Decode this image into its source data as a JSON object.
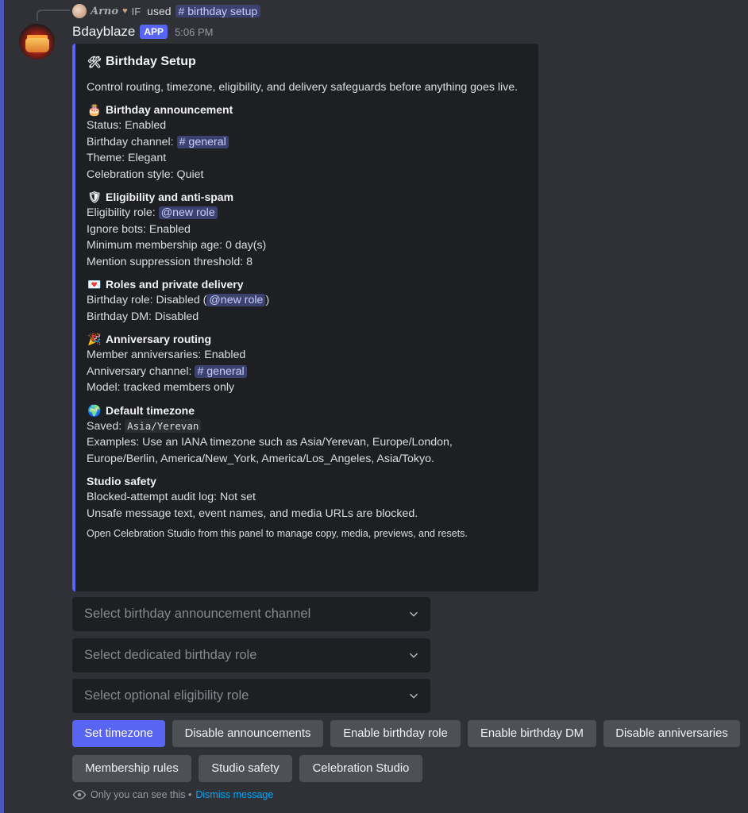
{
  "reply": {
    "user_name": "Arno",
    "heart": "♥",
    "tag": "IF",
    "used_text": "used",
    "command": "# birthday setup"
  },
  "message": {
    "bot_name": "Bdayblaze",
    "badge": "APP",
    "timestamp": "5:06 PM"
  },
  "embed": {
    "title_emoji": "🛠",
    "title": "Birthday Setup",
    "description": "Control routing, timezone, eligibility, and delivery safeguards before anything goes live.",
    "accent_color": "#5865f2",
    "sections": {
      "announcement": {
        "emoji": "🎂",
        "heading": "Birthday announcement",
        "status": "Status: Enabled",
        "channel_label": "Birthday channel:",
        "channel_mention": "# general",
        "theme": "Theme: Elegant",
        "style": "Celebration style: Quiet"
      },
      "eligibility": {
        "emoji": "🛡",
        "heading": "Eligibility and anti-spam",
        "role_label": "Eligibility role:",
        "role_mention": "@new role",
        "ignore_bots": "Ignore bots: Enabled",
        "min_age": "Minimum membership age: 0 day(s)",
        "mention_threshold": "Mention suppression threshold: 8"
      },
      "roles": {
        "emoji": "💌",
        "heading": "Roles and private delivery",
        "role_prefix": "Birthday role: Disabled (",
        "role_mention": "@new role",
        "role_suffix": ")",
        "dm": "Birthday DM: Disabled"
      },
      "anniversary": {
        "emoji": "🎉",
        "heading": "Anniversary routing",
        "members": "Member anniversaries: Enabled",
        "channel_label": "Anniversary channel:",
        "channel_mention": "# general",
        "model": "Model: tracked members only"
      },
      "timezone": {
        "emoji": "🌍",
        "heading": "Default timezone",
        "saved_label": "Saved:",
        "saved_value": "Asia/Yerevan",
        "examples": "Examples: Use an IANA timezone such as Asia/Yerevan, Europe/London, Europe/Berlin, America/New_York, America/Los_Angeles, Asia/Tokyo."
      },
      "safety": {
        "heading": "Studio safety",
        "audit": "Blocked-attempt audit log: Not set",
        "unsafe": "Unsafe message text, event names, and media URLs are blocked."
      }
    },
    "footer": "Open Celebration Studio from this panel to manage copy, media, previews, and resets."
  },
  "selects": [
    {
      "placeholder": "Select birthday announcement channel"
    },
    {
      "placeholder": "Select dedicated birthday role"
    },
    {
      "placeholder": "Select optional eligibility role"
    }
  ],
  "buttons": {
    "set_timezone": "Set timezone",
    "disable_announcements": "Disable announcements",
    "enable_birthday_role": "Enable birthday role",
    "enable_birthday_dm": "Enable birthday DM",
    "disable_anniversaries": "Disable anniversaries",
    "membership_rules": "Membership rules",
    "studio_safety": "Studio safety",
    "celebration_studio": "Celebration Studio"
  },
  "ephemeral": {
    "text": "Only you can see this •",
    "dismiss": "Dismiss message"
  },
  "colors": {
    "background": "#313338",
    "embed_bg": "#1e1f22",
    "primary": "#5865f2",
    "secondary_button": "#4e5058",
    "link": "#00a8fc"
  }
}
